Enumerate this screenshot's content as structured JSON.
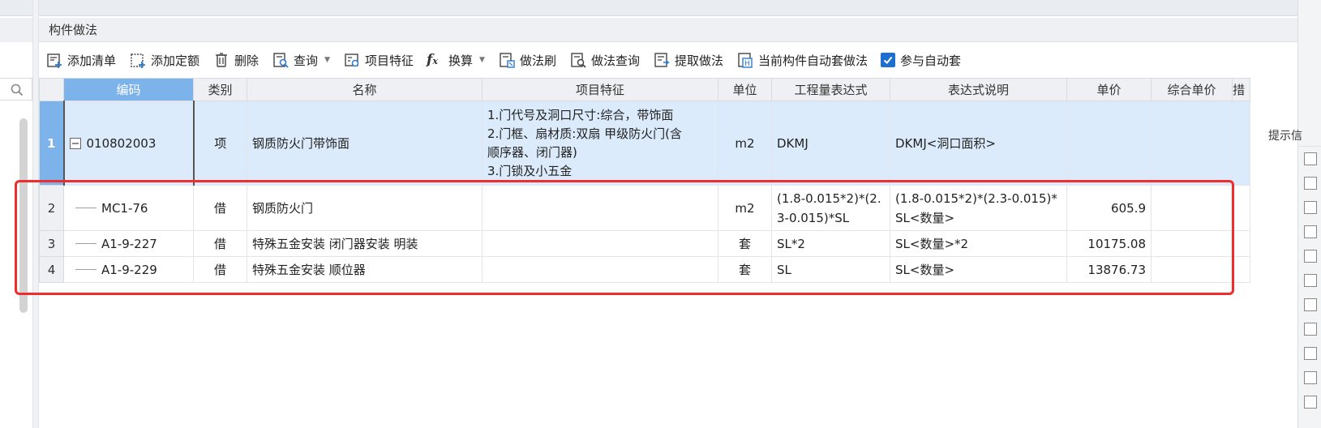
{
  "panel": {
    "title": "构件做法"
  },
  "toolbar": {
    "add_list": "添加清单",
    "add_quota": "添加定额",
    "delete": "删除",
    "query": "查询",
    "item_features": "项目特征",
    "convert": "换算",
    "method_brush": "做法刷",
    "method_query": "做法查询",
    "extract_method": "提取做法",
    "auto_apply_current": "当前构件自动套做法",
    "join_auto_apply": "参与自动套",
    "join_auto_apply_checked": true
  },
  "table": {
    "headers": [
      "编码",
      "类别",
      "名称",
      "项目特征",
      "单位",
      "工程量表达式",
      "表达式说明",
      "单价",
      "综合单价",
      "措"
    ],
    "rows": [
      {
        "num": "1",
        "code": "010802003",
        "type": "项",
        "name": "钢质防火门带饰面",
        "features": [
          "1.门代号及洞口尺寸:综合，带饰面",
          "2.门框、扇材质:双扇 甲级防火门(含",
          "顺序器、闭门器)",
          "3.门锁及小五金"
        ],
        "unit": "m2",
        "expr": "DKMJ",
        "expr_desc": "DKMJ<洞口面积>",
        "price": "",
        "total_price": ""
      },
      {
        "num": "2",
        "code": "MC1-76",
        "type": "借",
        "name": "钢质防火门",
        "features": [],
        "unit": "m2",
        "expr": "(1.8-0.015*2)*(2.3-0.015)*SL",
        "expr_desc": "(1.8-0.015*2)*(2.3-0.015)*SL<数量>",
        "price": "605.9",
        "total_price": ""
      },
      {
        "num": "3",
        "code": "A1-9-227",
        "type": "借",
        "name": "特殊五金安装 闭门器安装 明装",
        "features": [],
        "unit": "套",
        "expr": "SL*2",
        "expr_desc": "SL<数量>*2",
        "price": "10175.08",
        "total_price": ""
      },
      {
        "num": "4",
        "code": "A1-9-229",
        "type": "借",
        "name": "特殊五金安装 顺位器",
        "features": [],
        "unit": "套",
        "expr": "SL",
        "expr_desc": "SL<数量>",
        "price": "13876.73",
        "total_price": ""
      }
    ]
  },
  "right_panel": {
    "hint": "提示信"
  },
  "colors": {
    "selected_header": "#7cb3ea",
    "selected_row": "#dcebfb",
    "highlight": "#f02d2d",
    "checkbox": "#1d6fd1"
  },
  "icons": [
    "search-icon",
    "add-list-icon",
    "add-quota-icon",
    "delete-icon",
    "query-icon",
    "item-features-icon",
    "fx-icon",
    "brush-icon",
    "method-query-icon",
    "extract-icon",
    "auto-apply-icon",
    "checkbox-checked-icon"
  ]
}
